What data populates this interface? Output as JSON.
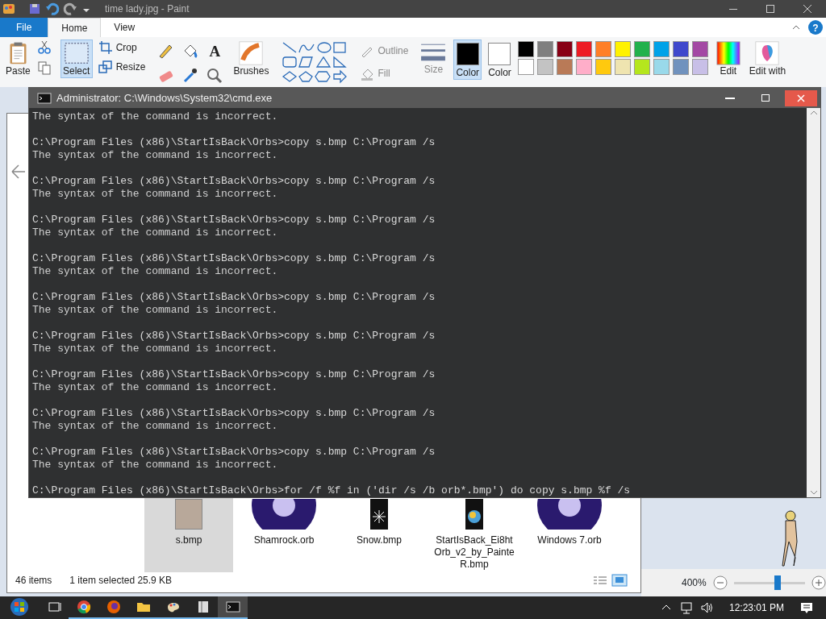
{
  "paint": {
    "title": "time lady.jpg - Paint",
    "tabs": [
      {
        "label": "File",
        "selected": false,
        "kind": "file"
      },
      {
        "label": "Home",
        "selected": true,
        "kind": "tab"
      },
      {
        "label": "View",
        "selected": false,
        "kind": "tab"
      }
    ],
    "help": "?",
    "ribbon": {
      "paste": "Paste",
      "select": "Select",
      "image_tools": [
        "Crop",
        "Resize"
      ],
      "text_tool": "A",
      "brushes": "Brushes",
      "outline": "Outline",
      "fill": "Fill",
      "size": "Size",
      "color1": {
        "label": "Color",
        "color": "#000000"
      },
      "color2": {
        "label": "Color",
        "color": "#ffffff"
      },
      "palette": [
        {
          "color": "#000000"
        },
        {
          "color": "#7f7f7f"
        },
        {
          "color": "#880015"
        },
        {
          "color": "#ed1c24"
        },
        {
          "color": "#ff7f27"
        },
        {
          "color": "#fff200"
        },
        {
          "color": "#22b14c"
        },
        {
          "color": "#00a2e8"
        },
        {
          "color": "#3f48cc"
        },
        {
          "color": "#a349a4"
        },
        {
          "color": "#ffffff"
        },
        {
          "color": "#c3c3c3"
        },
        {
          "color": "#b97a57"
        },
        {
          "color": "#ffaec9"
        },
        {
          "color": "#ffc90e"
        },
        {
          "color": "#efe4b0"
        },
        {
          "color": "#b5e61d"
        },
        {
          "color": "#99d9ea"
        },
        {
          "color": "#7092be"
        },
        {
          "color": "#c8bfe7"
        }
      ],
      "edit_colors": "Edit",
      "edit_paint3d": "Edit with"
    },
    "zoom": {
      "text": "400%",
      "level": 0.62
    }
  },
  "cmd": {
    "title": "Administrator: C:\\Windows\\System32\\cmd.exe",
    "lines": [
      {
        "kind": "output",
        "text": "The syntax of the command is incorrect."
      },
      {
        "kind": "command",
        "text": "C:\\Program Files (x86)\\StartIsBack\\Orbs>copy s.bmp C:\\Program /s"
      },
      {
        "kind": "output",
        "text": "The syntax of the command is incorrect."
      },
      {
        "kind": "command",
        "text": "C:\\Program Files (x86)\\StartIsBack\\Orbs>copy s.bmp C:\\Program /s"
      },
      {
        "kind": "output",
        "text": "The syntax of the command is incorrect."
      },
      {
        "kind": "command",
        "text": "C:\\Program Files (x86)\\StartIsBack\\Orbs>copy s.bmp C:\\Program /s"
      },
      {
        "kind": "output",
        "text": "The syntax of the command is incorrect."
      },
      {
        "kind": "command",
        "text": "C:\\Program Files (x86)\\StartIsBack\\Orbs>copy s.bmp C:\\Program /s"
      },
      {
        "kind": "output",
        "text": "The syntax of the command is incorrect."
      },
      {
        "kind": "command",
        "text": "C:\\Program Files (x86)\\StartIsBack\\Orbs>copy s.bmp C:\\Program /s"
      },
      {
        "kind": "output",
        "text": "The syntax of the command is incorrect."
      },
      {
        "kind": "command",
        "text": "C:\\Program Files (x86)\\StartIsBack\\Orbs>copy s.bmp C:\\Program /s"
      },
      {
        "kind": "output",
        "text": "The syntax of the command is incorrect."
      },
      {
        "kind": "command",
        "text": "C:\\Program Files (x86)\\StartIsBack\\Orbs>copy s.bmp C:\\Program /s"
      },
      {
        "kind": "output",
        "text": "The syntax of the command is incorrect."
      },
      {
        "kind": "command",
        "text": "C:\\Program Files (x86)\\StartIsBack\\Orbs>copy s.bmp C:\\Program /s"
      },
      {
        "kind": "output",
        "text": "The syntax of the command is incorrect."
      },
      {
        "kind": "command",
        "text": "C:\\Program Files (x86)\\StartIsBack\\Orbs>copy s.bmp C:\\Program /s"
      },
      {
        "kind": "output",
        "text": "The syntax of the command is incorrect."
      },
      {
        "kind": "command",
        "text": "C:\\Program Files (x86)\\StartIsBack\\Orbs>for /f %f in ('dir /s /b orb*.bmp') do copy s.bmp %f /s"
      }
    ]
  },
  "explorer": {
    "files": [
      {
        "name": "s.bmp",
        "kind": "photo",
        "selected": true
      },
      {
        "name": "Shamrock.orb",
        "kind": "orb",
        "selected": false
      },
      {
        "name": "Snow.bmp",
        "kind": "snow",
        "selected": false
      },
      {
        "name": "StartIsBack_Ei8htOrb_v2_by_PainteR.bmp",
        "kind": "strip",
        "selected": false
      },
      {
        "name": "Windows 7.orb",
        "kind": "orb",
        "selected": false
      }
    ],
    "status": {
      "count": "46 items",
      "selection": "1 item selected  25.9 KB"
    }
  },
  "taskbar": {
    "apps": [
      {
        "kind": "taskview",
        "active": false
      },
      {
        "kind": "chrome",
        "active": false
      },
      {
        "kind": "firefox",
        "active": false
      },
      {
        "kind": "folder",
        "active": false
      },
      {
        "kind": "paint",
        "active": false
      },
      {
        "kind": "book",
        "active": false
      },
      {
        "kind": "cmd",
        "active": true
      }
    ],
    "clock": "12:23:01 PM"
  }
}
